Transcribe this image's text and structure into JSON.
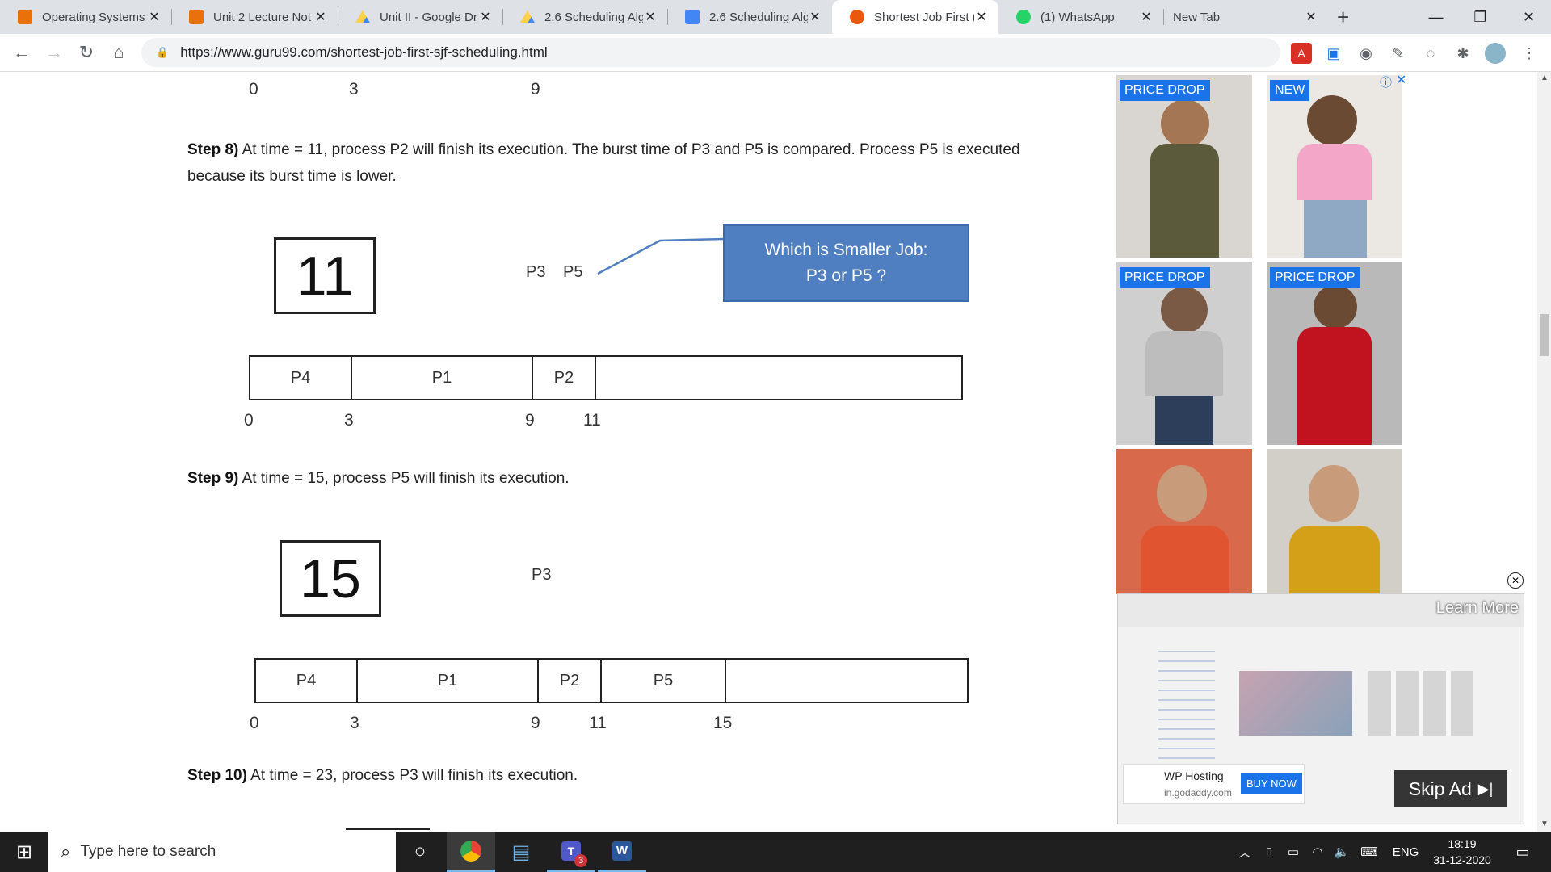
{
  "browser": {
    "tabs": [
      {
        "title": "Operating Systems",
        "fav_color": "#e8710a"
      },
      {
        "title": "Unit 2 Lecture Not",
        "fav_color": "#e8710a"
      },
      {
        "title": "Unit II - Google Dr",
        "fav_color": "#1fa463"
      },
      {
        "title": "2.6 Scheduling Alg",
        "fav_color": "#1fa463"
      },
      {
        "title": "2.6 Scheduling Alg",
        "fav_color": "#4285f4"
      },
      {
        "title": "Shortest Job First (",
        "fav_color": "#e8590c"
      },
      {
        "title": "(1) WhatsApp",
        "fav_color": "#25d366"
      },
      {
        "title": "New Tab",
        "fav_color": ""
      }
    ],
    "url": "https://www.guru99.com/shortest-job-first-sjf-scheduling.html"
  },
  "article": {
    "top_axis": [
      "0",
      "3",
      "9"
    ],
    "step8": {
      "label": "Step 8)",
      "text": " At time = 11, process P2 will finish its execution. The burst time of P3 and P5 is compared. Process P5 is executed because its burst time is lower.",
      "time": "11",
      "ready_a": "P3",
      "ready_b": "P5",
      "callout_line1": "Which is Smaller Job:",
      "callout_line2": "P3 or P5 ?",
      "gantt": [
        "P4",
        "P1",
        "P2",
        ""
      ],
      "axis": [
        "0",
        "3",
        "9",
        "11"
      ]
    },
    "step9": {
      "label": "Step 9)",
      "text": " At time = 15, process P5 will finish its execution.",
      "time": "15",
      "ready": "P3",
      "gantt": [
        "P4",
        "P1",
        "P2",
        "P5",
        ""
      ],
      "axis": [
        "0",
        "3",
        "9",
        "11",
        "15"
      ]
    },
    "step10": {
      "label": "Step 10)",
      "text": " At time = 23, process P3 will finish its execution."
    }
  },
  "ads": {
    "tiles": [
      {
        "badge": "PRICE DROP",
        "bg": "#d9d6d2",
        "outfit": "#5b5a3a"
      },
      {
        "badge": "NEW",
        "bg": "#ebe8e4",
        "outfit": "#f3a6c8"
      },
      {
        "badge": "PRICE DROP",
        "bg": "#cfcfcf",
        "outfit": "#bdbdbd"
      },
      {
        "badge": "PRICE DROP",
        "bg": "#b9b9b9",
        "outfit": "#c1121f"
      },
      {
        "badge": "",
        "bg": "#d8694a",
        "outfit": "#e0552f"
      },
      {
        "badge": "",
        "bg": "#d2cec8",
        "outfit": "#d4a017"
      }
    ],
    "video": {
      "learn_more": "Learn More",
      "brand": "WP Hosting",
      "domain": "in.godaddy.com",
      "buy": "BUY NOW",
      "skip": "Skip Ad"
    }
  },
  "taskbar": {
    "search_placeholder": "Type here to search",
    "lang": "ENG",
    "time": "18:19",
    "date": "31-12-2020",
    "teams_badge": "3"
  }
}
